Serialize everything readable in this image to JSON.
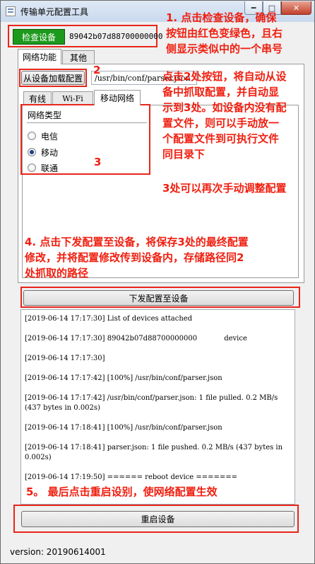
{
  "window": {
    "title": "传输单元配置工具",
    "controls": {
      "minimize": "━",
      "maximize": "□",
      "close": "✕"
    }
  },
  "device": {
    "check_button": "检查设备",
    "serial": "89042b07d88700000000",
    "check_button_color": "#1c9a1c"
  },
  "tabs": {
    "network": "网络功能",
    "other": "其他"
  },
  "load_config": {
    "button": "从设备加载配置",
    "path": "/usr/bin/conf/parser.json"
  },
  "subtabs": {
    "wired": "有线",
    "wifi": "Wi-Fi",
    "mobile": "移动网络"
  },
  "network_type": {
    "heading": "网络类型",
    "options": [
      {
        "label": "电信",
        "checked": false
      },
      {
        "label": "移动",
        "checked": true
      },
      {
        "label": "联通",
        "checked": false
      }
    ]
  },
  "buttons": {
    "push_config": "下发配置至设备",
    "reboot": "重启设备"
  },
  "log": [
    "[2019-06-14 17:17:30] List of devices attached",
    "[2019-06-14 17:17:30] 89042b07d88700000000            device",
    "[2019-06-14 17:17:30]",
    "[2019-06-14 17:17:42] [100%] /usr/bin/conf/parser.json",
    "[2019-06-14 17:17:42] /usr/bin/conf/parser.json: 1 file pulled. 0.2 MB/s (437 bytes in 0.002s)",
    "[2019-06-14 17:18:41] [100%] /usr/bin/conf/parser.json",
    "[2019-06-14 17:18:41] parser.json: 1 file pushed. 0.2 MB/s (437 bytes in 0.002s)",
    "[2019-06-14 17:19:50] ====== reboot device ======="
  ],
  "version": "version: 20190614001",
  "annotations": {
    "step1": [
      "1. 点击检查设备，确保",
      "按钮由红色变绿色，且右",
      "侧显示类似中的一个串号"
    ],
    "label2": "2",
    "step2": [
      "点击2处按钮，将自动从设",
      "备中抓取配置，并自动显",
      "示到3处。如设备内没有配",
      "置文件，则可以手动放一",
      "个配置文件到可执行文件",
      "同目录下"
    ],
    "label3": "3",
    "step3b": "3处可以再次手动调整配置",
    "step4": [
      "4. 点击下发配置至设备，将保存3处的最终配置",
      "修改，并将配置修改传到设备内，存储路径同2",
      "处抓取的路径"
    ],
    "step5": "5。 最后点击重启设别，使网络配置生效",
    "color": "#e8261c"
  }
}
